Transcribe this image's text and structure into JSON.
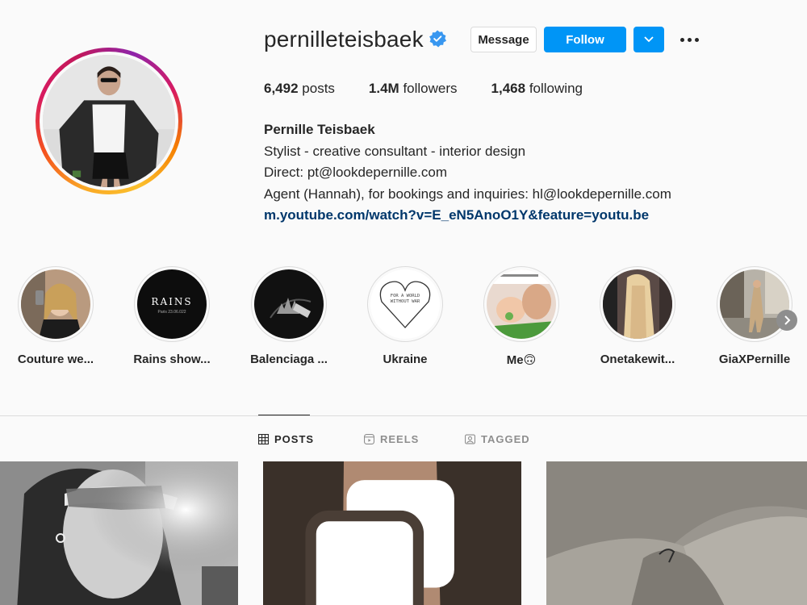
{
  "profile": {
    "username": "pernilleteisbaek",
    "verified": true,
    "buttons": {
      "message": "Message",
      "follow": "Follow"
    },
    "stats": {
      "posts_count": "6,492",
      "posts_label": "posts",
      "followers_count": "1.4M",
      "followers_label": "followers",
      "following_count": "1,468",
      "following_label": "following"
    },
    "bio": {
      "full_name": "Pernille Teisbaek",
      "line1": "Stylist - creative consultant - interior design",
      "line2": "Direct: pt@lookdepernille.com",
      "line3": "Agent (Hannah), for bookings and inquiries: hl@lookdepernille.com",
      "link": "m.youtube.com/watch?v=E_eN5AnoO1Y&feature=youtu.be"
    }
  },
  "highlights": [
    {
      "label": "Couture we..."
    },
    {
      "label": "Rains show...",
      "cover_text": "RAINS",
      "cover_subtext": "Paris 23.06.022"
    },
    {
      "label": "Balenciaga ..."
    },
    {
      "label": "Ukraine",
      "cover_text": "FOR A WORLD WITHOUT WAR"
    },
    {
      "label": "Me🙃"
    },
    {
      "label": "Onetakewit..."
    },
    {
      "label": "GiaXPernille"
    }
  ],
  "tabs": [
    {
      "label": "POSTS",
      "icon": "grid-icon",
      "active": true
    },
    {
      "label": "REELS",
      "icon": "reels-icon",
      "active": false
    },
    {
      "label": "TAGGED",
      "icon": "tagged-icon",
      "active": false
    }
  ],
  "colors": {
    "primary_blue": "#0095f6",
    "link_blue": "#00376b",
    "text": "#262626",
    "muted": "#8e8e8e",
    "border": "#dbdbdb",
    "background": "#fafafa"
  }
}
